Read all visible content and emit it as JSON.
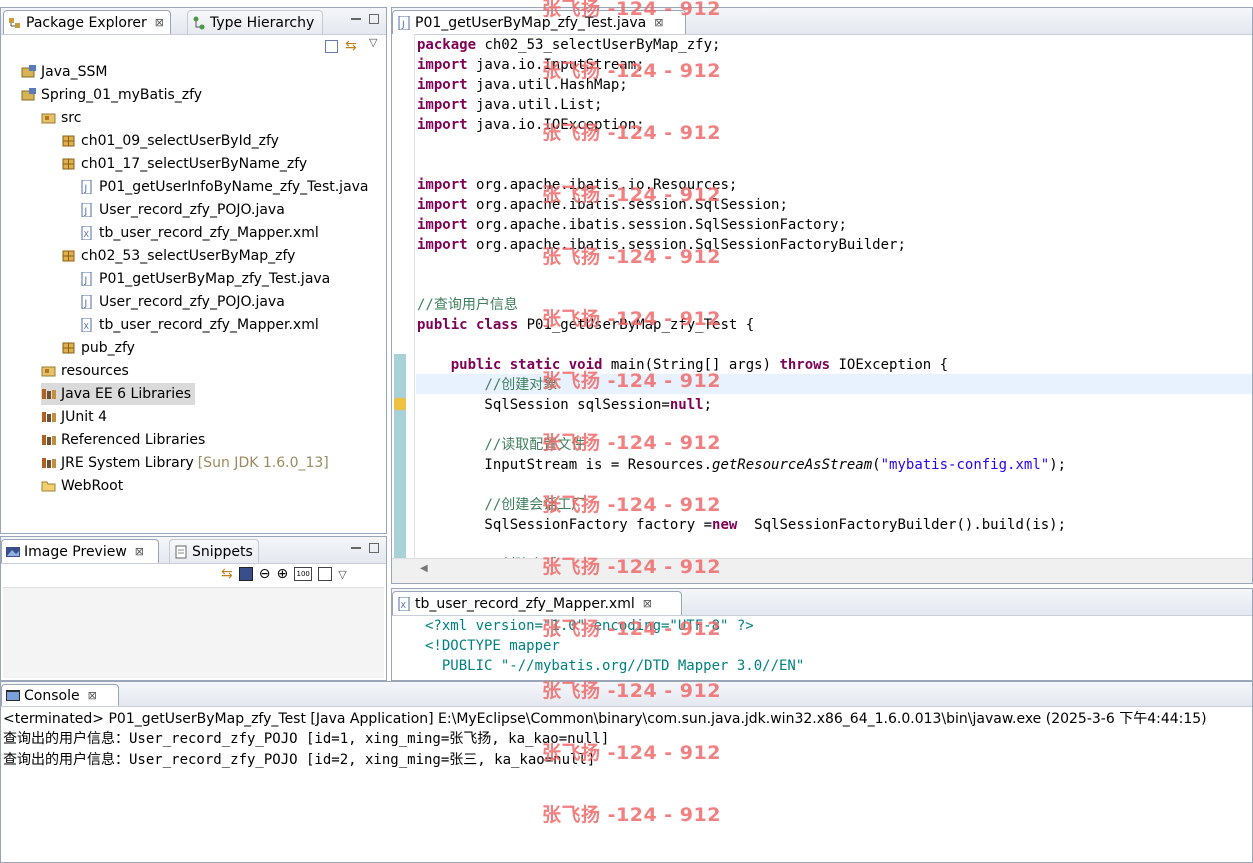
{
  "package_explorer": {
    "tabs": [
      {
        "label": "Package Explorer",
        "close": "⊠"
      },
      {
        "label": "Type Hierarchy"
      }
    ],
    "tree": [
      {
        "label": "Java_SSM",
        "icon": "project-icon"
      },
      {
        "label": "Spring_01_myBatis_zfy",
        "icon": "project-icon"
      },
      {
        "label": "src",
        "icon": "source-folder-icon"
      },
      {
        "label": "ch01_09_selectUserById_zfy",
        "icon": "package-icon"
      },
      {
        "label": "ch01_17_selectUserByName_zfy",
        "icon": "package-icon"
      },
      {
        "label": "P01_getUserInfoByName_zfy_Test.java",
        "icon": "java-file-icon"
      },
      {
        "label": "User_record_zfy_POJO.java",
        "icon": "java-file-icon"
      },
      {
        "label": "tb_user_record_zfy_Mapper.xml",
        "icon": "xml-file-icon"
      },
      {
        "label": "ch02_53_selectUserByMap_zfy",
        "icon": "package-icon"
      },
      {
        "label": "P01_getUserByMap_zfy_Test.java",
        "icon": "java-file-icon"
      },
      {
        "label": "User_record_zfy_POJO.java",
        "icon": "java-file-icon"
      },
      {
        "label": "tb_user_record_zfy_Mapper.xml",
        "icon": "xml-file-icon"
      },
      {
        "label": "pub_zfy",
        "icon": "package-icon"
      },
      {
        "label": "resources",
        "icon": "source-folder-icon"
      },
      {
        "label": "Java EE 6 Libraries",
        "icon": "library-icon"
      },
      {
        "label": "JUnit 4",
        "icon": "library-icon"
      },
      {
        "label": "Referenced Libraries",
        "icon": "library-icon"
      },
      {
        "label": "JRE System Library",
        "suffix": "[Sun JDK 1.6.0_13]",
        "icon": "library-icon"
      },
      {
        "label": "WebRoot",
        "icon": "folder-icon"
      }
    ]
  },
  "image_preview": {
    "tabs": [
      {
        "label": "Image Preview",
        "close": "⊠"
      },
      {
        "label": "Snippets"
      }
    ]
  },
  "editor": {
    "tab_label": "P01_getUserByMap_zfy_Test.java",
    "tab_close": "⊠",
    "lines": [
      [
        {
          "k": "kw",
          "t": "package"
        },
        {
          "t": " ch02_53_selectUserByMap_zfy;"
        }
      ],
      [
        {
          "k": "kw",
          "t": "import"
        },
        {
          "t": " java.io.InputStream;"
        }
      ],
      [
        {
          "k": "kw",
          "t": "import"
        },
        {
          "t": " java.util.HashMap;"
        }
      ],
      [
        {
          "k": "kw",
          "t": "import"
        },
        {
          "t": " java.util.List;"
        }
      ],
      [
        {
          "k": "kw",
          "t": "import"
        },
        {
          "t": " java.io.IOException;"
        }
      ],
      [],
      [],
      [
        {
          "k": "kw",
          "t": "import"
        },
        {
          "t": " org.apache.ibatis.io.Resources;"
        }
      ],
      [
        {
          "k": "kw",
          "t": "import"
        },
        {
          "t": " org.apache.ibatis.session.SqlSession;"
        }
      ],
      [
        {
          "k": "kw",
          "t": "import"
        },
        {
          "t": " org.apache.ibatis.session.SqlSessionFactory;"
        }
      ],
      [
        {
          "k": "kw",
          "t": "import"
        },
        {
          "t": " org.apache.ibatis.session.SqlSessionFactoryBuilder;"
        }
      ],
      [],
      [],
      [
        {
          "k": "cm",
          "t": "//查询用户信息"
        }
      ],
      [
        {
          "k": "kw",
          "t": "public class"
        },
        {
          "t": " P01_getUserByMap_zfy_Test {"
        }
      ],
      [],
      [
        {
          "t": "    "
        },
        {
          "k": "kw",
          "t": "public static void"
        },
        {
          "t": " main(String[] args) "
        },
        {
          "k": "kw",
          "t": "throws"
        },
        {
          "t": " IOException {"
        }
      ],
      [
        {
          "t": "        "
        },
        {
          "k": "cm",
          "t": "//创建对象"
        }
      ],
      [
        {
          "t": "        SqlSession sqlSession="
        },
        {
          "k": "kw",
          "t": "null"
        },
        {
          "t": ";"
        }
      ],
      [],
      [
        {
          "t": "        "
        },
        {
          "k": "cm",
          "t": "//读取配置文件"
        }
      ],
      [
        {
          "t": "        InputStream is = Resources."
        },
        {
          "k": "it",
          "t": "getResourceAsStream"
        },
        {
          "t": "("
        },
        {
          "k": "st",
          "t": "\"mybatis-config.xml\""
        },
        {
          "t": ");"
        }
      ],
      [],
      [
        {
          "t": "        "
        },
        {
          "k": "cm",
          "t": "//创建会话工厂"
        }
      ],
      [
        {
          "t": "        SqlSessionFactory factory ="
        },
        {
          "k": "kw",
          "t": "new"
        },
        {
          "t": "  SqlSessionFactoryBuilder().build(is);"
        }
      ],
      [],
      [
        {
          "t": "        "
        },
        {
          "k": "cm",
          "t": "//创建会话"
        }
      ]
    ]
  },
  "xml_editor": {
    "tab_label": "tb_user_record_zfy_Mapper.xml",
    "tab_close": "⊠",
    "lines": [
      "<?xml version=\"1.0\" encoding=\"UTF-8\" ?>",
      "<!DOCTYPE mapper",
      "  PUBLIC \"-//mybatis.org//DTD Mapper 3.0//EN\""
    ]
  },
  "console": {
    "tab_label": "Console",
    "tab_close": "⊠",
    "header": "<terminated> P01_getUserByMap_zfy_Test [Java Application] E:\\MyEclipse\\Common\\binary\\com.sun.java.jdk.win32.x86_64_1.6.0.013\\bin\\javaw.exe (2025-3-6 下午4:44:15)",
    "output": [
      "查询出的用户信息：User_record_zfy_POJO [id=1, xing_ming=张飞扬, ka_kao=null]",
      "查询出的用户信息：User_record_zfy_POJO [id=2, xing_ming=张三, ka_kao=null]"
    ]
  },
  "watermark": "张飞扬 -124 - 912",
  "colors": {
    "keyword": "#7f0055",
    "comment": "#3f7f5f",
    "string": "#2a00ff",
    "watermark": "#f06a6a",
    "current_line": "#e8f2fe"
  }
}
